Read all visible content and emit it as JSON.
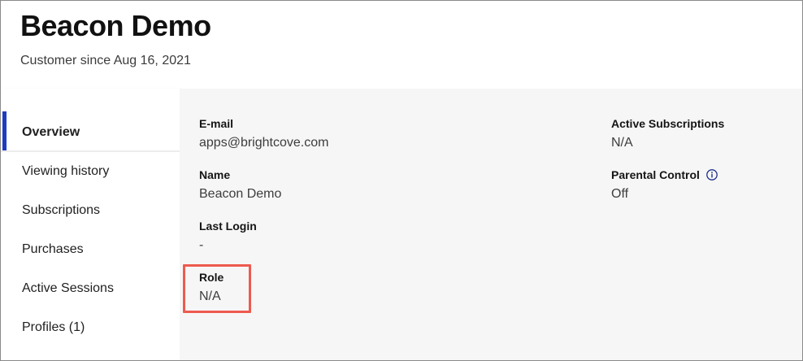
{
  "header": {
    "title": "Beacon Demo",
    "subtitle": "Customer since Aug 16, 2021"
  },
  "sidebar": {
    "items": [
      {
        "label": "Overview",
        "active": true
      },
      {
        "label": "Viewing history",
        "active": false
      },
      {
        "label": "Subscriptions",
        "active": false
      },
      {
        "label": "Purchases",
        "active": false
      },
      {
        "label": "Active Sessions",
        "active": false
      },
      {
        "label": "Profiles (1)",
        "active": false
      }
    ]
  },
  "details": {
    "email": {
      "label": "E-mail",
      "value": "apps@brightcove.com"
    },
    "name": {
      "label": "Name",
      "value": "Beacon Demo"
    },
    "last_login": {
      "label": "Last Login",
      "value": "-"
    },
    "role": {
      "label": "Role",
      "value": "N/A"
    },
    "active_subscriptions": {
      "label": "Active Subscriptions",
      "value": "N/A"
    },
    "parental_control": {
      "label": "Parental Control",
      "value": "Off",
      "icon": "info-icon"
    }
  },
  "colors": {
    "accent": "#1d3cbf",
    "highlight": "#ee5a4e",
    "panel_background": "#f6f6f6"
  }
}
